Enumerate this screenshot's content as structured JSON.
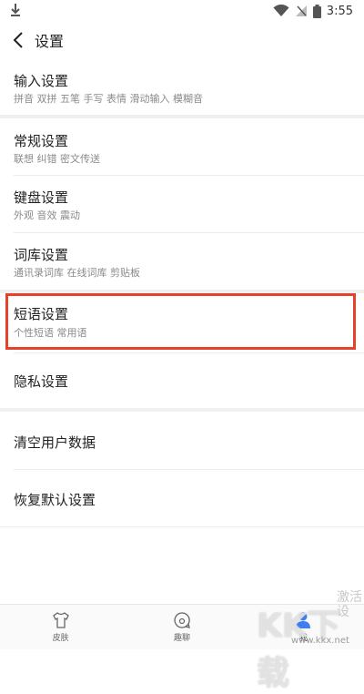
{
  "status_bar": {
    "time": "3:55"
  },
  "header": {
    "title": "设置"
  },
  "settings": [
    {
      "title": "输入设置",
      "subtitle": "拼音 双拼 五笔 手写 表情 滑动输入 模糊音"
    },
    {
      "title": "常规设置",
      "subtitle": "联想 纠错 密文传送"
    },
    {
      "title": "键盘设置",
      "subtitle": "外观 音效 震动"
    },
    {
      "title": "词库设置",
      "subtitle": "通讯录词库 在线词库 剪贴板"
    },
    {
      "title": "短语设置",
      "subtitle": "个性短语 常用语"
    },
    {
      "title": "隐私设置"
    },
    {
      "title": "清空用户数据"
    },
    {
      "title": "恢复默认设置"
    }
  ],
  "highlight_color": "#e8402a",
  "bottom_nav": [
    {
      "label": "皮肤",
      "icon": "shirt-icon"
    },
    {
      "label": "趣聊",
      "icon": "chat-bubble-icon"
    },
    {
      "label": "我",
      "icon": "person-icon",
      "active": true
    }
  ],
  "watermark": {
    "brand": "KK下载",
    "side_text": "激活\n设",
    "url": "www.kkx.net"
  }
}
